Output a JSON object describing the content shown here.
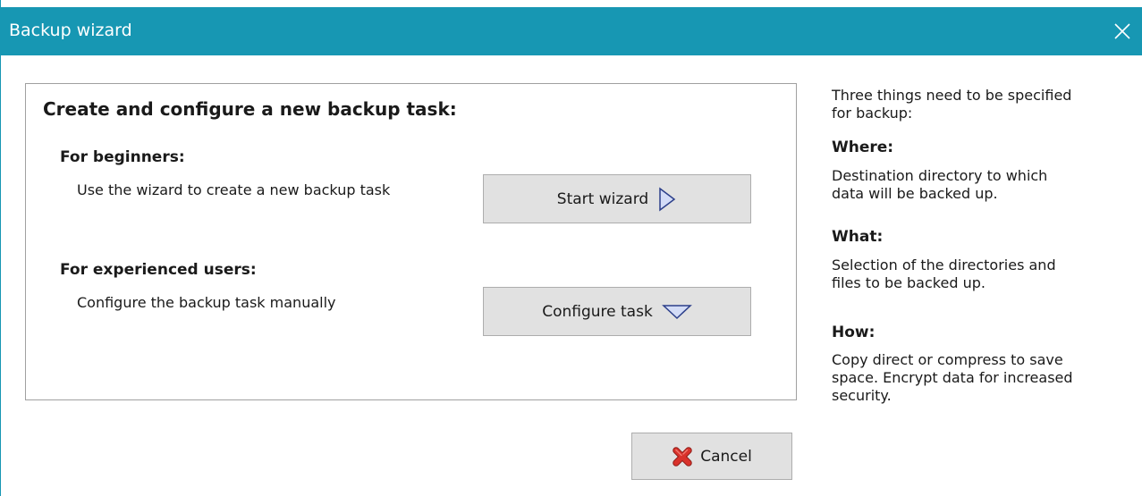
{
  "window": {
    "title": "Backup wizard",
    "close_icon": "close-icon"
  },
  "main": {
    "heading": "Create and configure a new backup task:",
    "beginners": {
      "heading": "For beginners:",
      "description": "Use the wizard to create a new backup task",
      "button_label": "Start wizard",
      "button_icon": "triangle-right-icon"
    },
    "experienced": {
      "heading": "For experienced users:",
      "description": "Configure the backup task manually",
      "button_label": "Configure task",
      "button_icon": "triangle-down-icon"
    }
  },
  "info": {
    "intro": [
      "Three things need to be specified",
      "for backup:"
    ],
    "where_heading": "Where:",
    "where_text": [
      "Destination directory to which",
      "data will be backed up."
    ],
    "what_heading": "What:",
    "what_text": [
      "Selection of the directories and",
      "files to be backed up."
    ],
    "how_heading": "How:",
    "how_text": [
      "Copy direct or compress to save",
      "space. Encrypt data for increased",
      "security."
    ]
  },
  "footer": {
    "cancel_label": "Cancel",
    "cancel_icon": "red-x-icon"
  },
  "colors": {
    "titlebar": "#1797b3",
    "button_bg": "#e1e1e1",
    "triangle_fill": "#d3dcf7",
    "triangle_stroke": "#2c3f8a",
    "cancel_icon": "#d9322b"
  }
}
